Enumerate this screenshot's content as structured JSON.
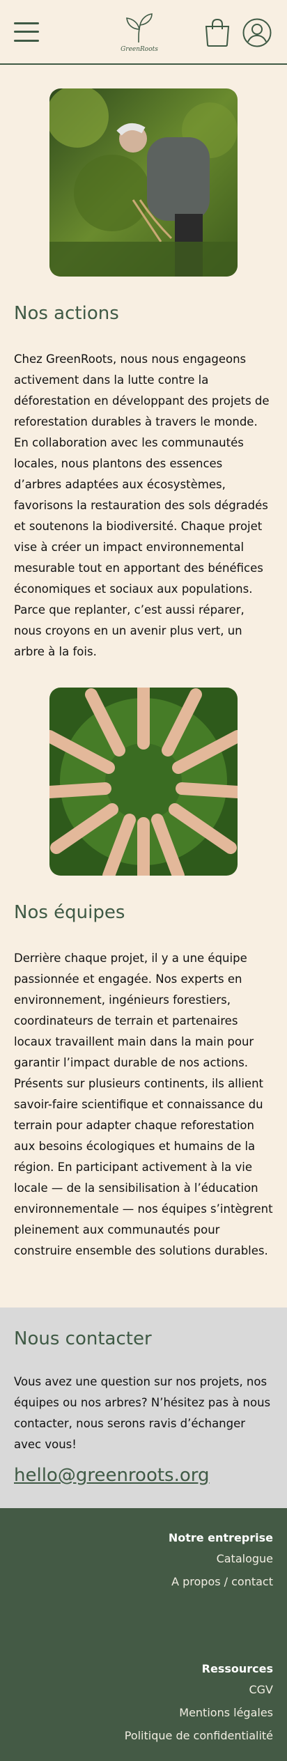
{
  "header": {
    "logo_text": "GreenRoots"
  },
  "actions": {
    "title": "Nos actions",
    "text": "Chez GreenRoots, nous nous engageons activement dans la lutte contre la déforestation en développant des projets de reforestation durables à travers le monde. En collaboration avec les communautés locales, nous plantons des essences d’arbres adaptées aux écosystèmes, favorisons la restauration des sols dégradés et soutenons la biodiversité. Chaque projet vise à créer un impact environnemental mesurable tout en apportant des bénéfices économiques et sociaux aux populations. Parce que replanter, c’est aussi réparer, nous croyons en un avenir plus vert, un arbre à la fois."
  },
  "teams": {
    "title": "Nos équipes",
    "text": "Derrière chaque projet, il y a une équipe passionnée et engagée. Nos experts en environnement, ingénieurs forestiers, coordinateurs de terrain et partenaires locaux travaillent main dans la main pour garantir l’impact durable de nos actions. Présents sur plusieurs continents, ils allient savoir-faire scientifique et connaissance du terrain pour adapter chaque reforestation aux besoins écologiques et humains de la région. En participant activement à la vie locale — de la sensibilisation à l’éducation environnementale — nos équipes s’intègrent pleinement aux communautés pour construire ensemble des solutions durables."
  },
  "contact": {
    "title": "Nous contacter",
    "text": "Vous avez une question sur nos projets, nos équipes ou nos arbres? N’hésitez pas à nous contacter, nous serons ravis d’échanger avec vous!",
    "email": "hello@greenroots.org"
  },
  "footer": {
    "company_title": "Notre entreprise",
    "company_links": [
      "Catalogue",
      "A propos / contact"
    ],
    "resources_title": "Ressources",
    "resources_links": [
      "CGV",
      "Mentions légales",
      "Politique de confidentialité"
    ]
  },
  "colors": {
    "background": "#f8efe2",
    "accent": "#3f5a45",
    "footer": "#445a45",
    "contact_bg": "#d9d9d9"
  },
  "icons": [
    "menu-icon",
    "sprout-logo-icon",
    "shopping-bag-icon",
    "user-account-icon"
  ]
}
